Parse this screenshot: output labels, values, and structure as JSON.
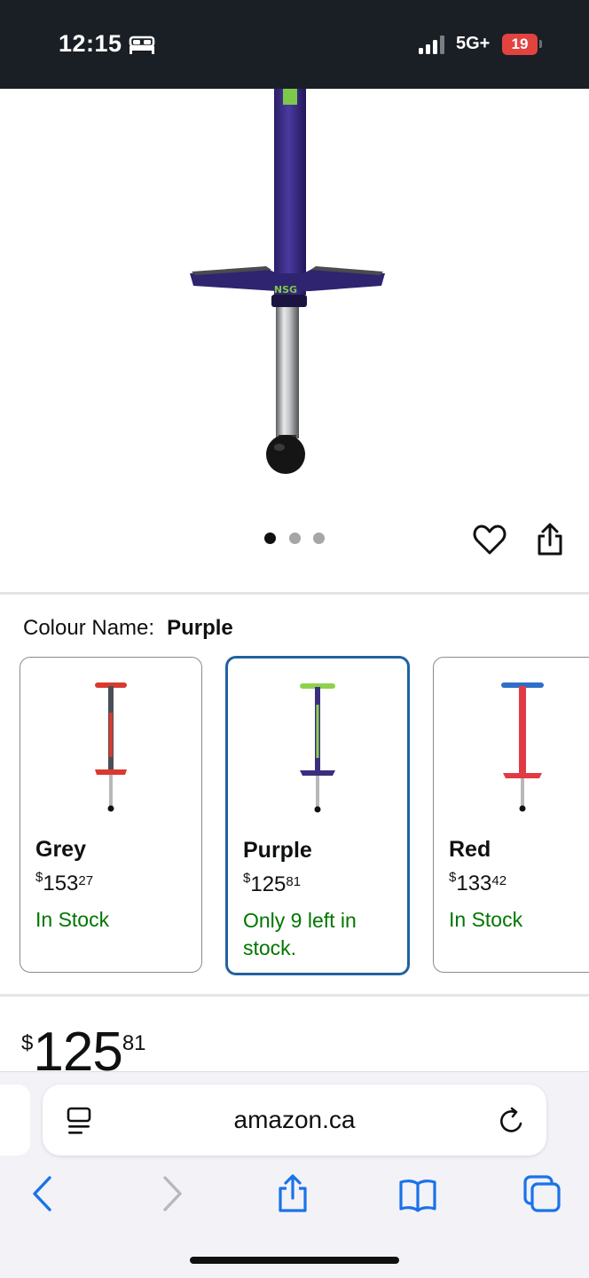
{
  "status_bar": {
    "time": "12:15",
    "network": "5G+",
    "battery": "19",
    "icons": [
      "bed-icon",
      "signal-icon",
      "battery-icon"
    ]
  },
  "product": {
    "image_icon": "pogo-stick-image",
    "dots": {
      "count": 3,
      "active_index": 0
    },
    "actions": [
      "heart-icon",
      "share-icon"
    ]
  },
  "colour": {
    "label": "Colour Name:",
    "selected": "Purple"
  },
  "variants": [
    {
      "name": "Grey",
      "currency": "$",
      "whole": "153",
      "cents": "27",
      "stock": "In Stock",
      "handle_color": "#d93a2f",
      "shaft_color": "#4a4f57",
      "peg_color": "#d93a2f"
    },
    {
      "name": "Purple",
      "currency": "$",
      "whole": "125",
      "cents": "81",
      "stock": "Only 9 left in stock.",
      "handle_color": "#8fd14f",
      "shaft_color": "#3b2e7e",
      "peg_color": "#3b2e7e"
    },
    {
      "name": "Red",
      "currency": "$",
      "whole": "133",
      "cents": "42",
      "stock": "In Stock",
      "handle_color": "#2f6fc8",
      "shaft_color": "#e23a45",
      "peg_color": "#e23a45"
    }
  ],
  "price": {
    "currency": "$",
    "whole": "125",
    "cents": "81"
  },
  "browser": {
    "url": "amazon.ca",
    "icons": [
      "reader-icon",
      "reload-icon",
      "back-icon",
      "forward-icon",
      "share-icon",
      "bookmarks-icon",
      "tabs-icon"
    ]
  },
  "colors": {
    "accent_blue": "#2162a1",
    "stock_green": "#007600",
    "status_bar_bg": "#1a1f26",
    "battery_red": "#e2433f",
    "ios_blue": "#1a73e8"
  }
}
